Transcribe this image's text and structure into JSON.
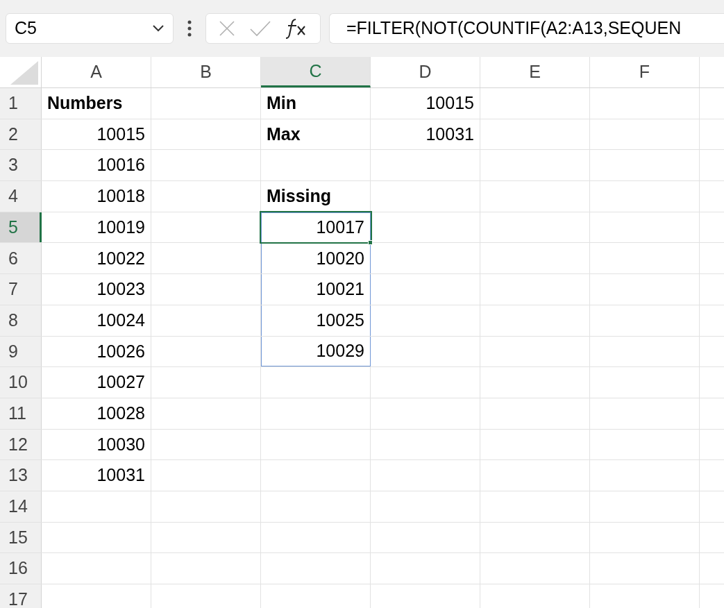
{
  "name_box": {
    "value": "C5"
  },
  "formula_bar": {
    "value": "=FILTER(NOT(COUNTIF(A2:A13,SEQUEN"
  },
  "columns": [
    {
      "label": "A",
      "selected": false
    },
    {
      "label": "B",
      "selected": false
    },
    {
      "label": "C",
      "selected": true
    },
    {
      "label": "D",
      "selected": false
    },
    {
      "label": "E",
      "selected": false
    },
    {
      "label": "F",
      "selected": false
    }
  ],
  "rows": [
    {
      "label": "1",
      "selected": false,
      "cells": [
        {
          "text": "Numbers",
          "kind": "text",
          "bold": true
        },
        null,
        {
          "text": "Min",
          "kind": "text",
          "bold": true
        },
        {
          "text": "10015",
          "kind": "number",
          "bold": false
        },
        null,
        null
      ]
    },
    {
      "label": "2",
      "selected": false,
      "cells": [
        {
          "text": "10015",
          "kind": "number",
          "bold": false
        },
        null,
        {
          "text": "Max",
          "kind": "text",
          "bold": true
        },
        {
          "text": "10031",
          "kind": "number",
          "bold": false
        },
        null,
        null
      ]
    },
    {
      "label": "3",
      "selected": false,
      "cells": [
        {
          "text": "10016",
          "kind": "number",
          "bold": false
        },
        null,
        null,
        null,
        null,
        null
      ]
    },
    {
      "label": "4",
      "selected": false,
      "cells": [
        {
          "text": "10018",
          "kind": "number",
          "bold": false
        },
        null,
        {
          "text": "Missing",
          "kind": "text",
          "bold": true
        },
        null,
        null,
        null
      ]
    },
    {
      "label": "5",
      "selected": true,
      "cells": [
        {
          "text": "10019",
          "kind": "number",
          "bold": false
        },
        null,
        {
          "text": "10017",
          "kind": "number",
          "bold": false,
          "selected": true,
          "spill": true
        },
        null,
        null,
        null
      ]
    },
    {
      "label": "6",
      "selected": false,
      "cells": [
        {
          "text": "10022",
          "kind": "number",
          "bold": false
        },
        null,
        {
          "text": "10020",
          "kind": "number",
          "bold": false,
          "selected": false,
          "spill": true
        },
        null,
        null,
        null
      ]
    },
    {
      "label": "7",
      "selected": false,
      "cells": [
        {
          "text": "10023",
          "kind": "number",
          "bold": false
        },
        null,
        {
          "text": "10021",
          "kind": "number",
          "bold": false,
          "selected": false,
          "spill": true
        },
        null,
        null,
        null
      ]
    },
    {
      "label": "8",
      "selected": false,
      "cells": [
        {
          "text": "10024",
          "kind": "number",
          "bold": false
        },
        null,
        {
          "text": "10025",
          "kind": "number",
          "bold": false,
          "selected": false,
          "spill": true
        },
        null,
        null,
        null
      ]
    },
    {
      "label": "9",
      "selected": false,
      "cells": [
        {
          "text": "10026",
          "kind": "number",
          "bold": false
        },
        null,
        {
          "text": "10029",
          "kind": "number",
          "bold": false,
          "selected": false,
          "spill": true
        },
        null,
        null,
        null
      ]
    },
    {
      "label": "10",
      "selected": false,
      "cells": [
        {
          "text": "10027",
          "kind": "number",
          "bold": false
        },
        null,
        null,
        null,
        null,
        null
      ]
    },
    {
      "label": "11",
      "selected": false,
      "cells": [
        {
          "text": "10028",
          "kind": "number",
          "bold": false
        },
        null,
        null,
        null,
        null,
        null
      ]
    },
    {
      "label": "12",
      "selected": false,
      "cells": [
        {
          "text": "10030",
          "kind": "number",
          "bold": false
        },
        null,
        null,
        null,
        null,
        null
      ]
    },
    {
      "label": "13",
      "selected": false,
      "cells": [
        {
          "text": "10031",
          "kind": "number",
          "bold": false
        },
        null,
        null,
        null,
        null,
        null
      ]
    },
    {
      "label": "14",
      "selected": false,
      "cells": [
        null,
        null,
        null,
        null,
        null,
        null
      ]
    },
    {
      "label": "15",
      "selected": false,
      "cells": [
        null,
        null,
        null,
        null,
        null,
        null
      ]
    },
    {
      "label": "16",
      "selected": false,
      "cells": [
        null,
        null,
        null,
        null,
        null,
        null
      ]
    },
    {
      "label": "17",
      "selected": false,
      "cells": [
        null,
        null,
        null,
        null,
        null,
        null
      ]
    }
  ]
}
